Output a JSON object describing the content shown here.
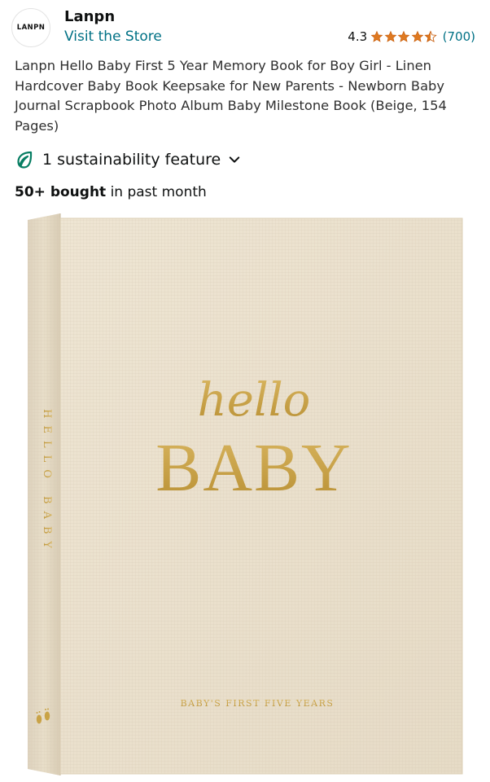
{
  "store": {
    "logo_text": "LANPN",
    "name": "Lanpn",
    "visit_link": "Visit the Store"
  },
  "rating": {
    "value": "4.3",
    "stars_value": 4.3,
    "stars_max": 5,
    "count": "(700)",
    "star_color": "#de7921"
  },
  "product": {
    "title": "Lanpn Hello Baby First 5 Year Memory Book for Boy Girl - Linen Hardcover Baby Book Keepsake for New Parents - Newborn Baby Journal Scrapbook Photo Album Baby Milestone Book (Beige, 154 Pages)"
  },
  "sustainability": {
    "label": "1 sustainability feature",
    "icon": "leaf-icon",
    "chevron_icon": "chevron-down-icon",
    "accent_color": "#067d62"
  },
  "purchases": {
    "bold": "50+ bought",
    "rest": " in past month"
  },
  "book": {
    "cover_script": "hello",
    "cover_title": "BABY",
    "spine_text": "HELLO BABY",
    "subtitle": "BABY'S FIRST FIVE YEARS",
    "linen_color": "#ebe1ce",
    "gold_color": "#c9a347"
  }
}
